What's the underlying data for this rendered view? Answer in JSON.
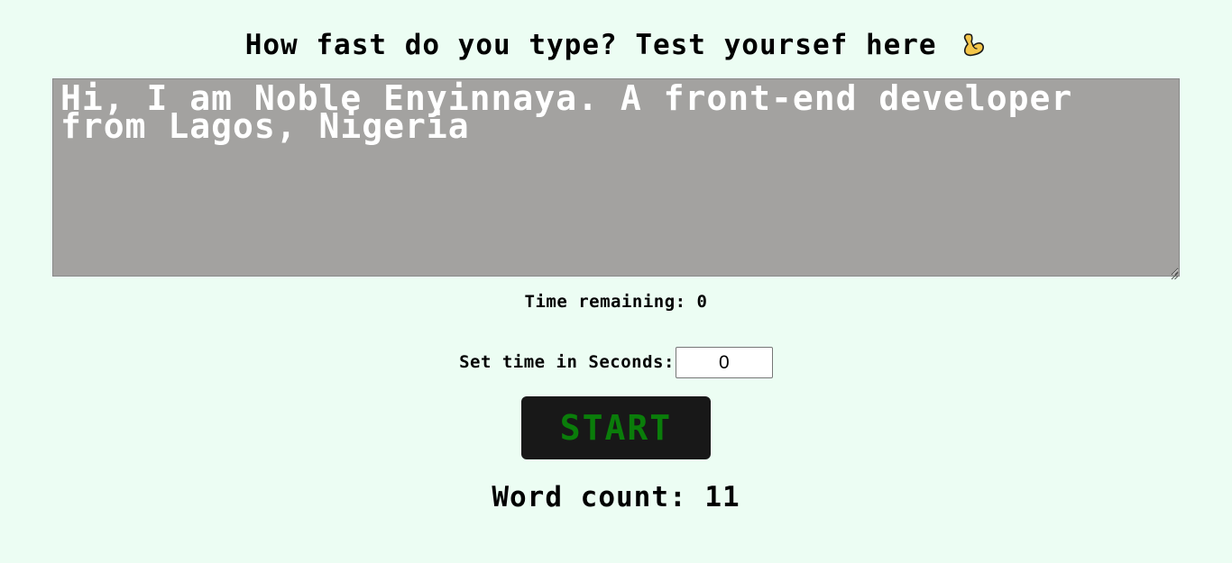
{
  "header": {
    "title": "How fast do you type? Test yoursef here",
    "title_icon": "flexed-biceps-icon"
  },
  "typing_area": {
    "text": "Hi, I am Noble Enyinnaya. A front-end developer from Lagos, Nigeria"
  },
  "timer": {
    "label": "Time remaining:",
    "value": "0"
  },
  "set_time": {
    "label": "Set time in Seconds:",
    "value": "0"
  },
  "start_button": {
    "label": "START"
  },
  "word_count": {
    "label": "Word count:",
    "value": "11"
  },
  "colors": {
    "background": "#ecfdf3",
    "textarea_background": "#a3a2a0",
    "button_background": "#181818",
    "button_text": "#0a7d0a"
  }
}
